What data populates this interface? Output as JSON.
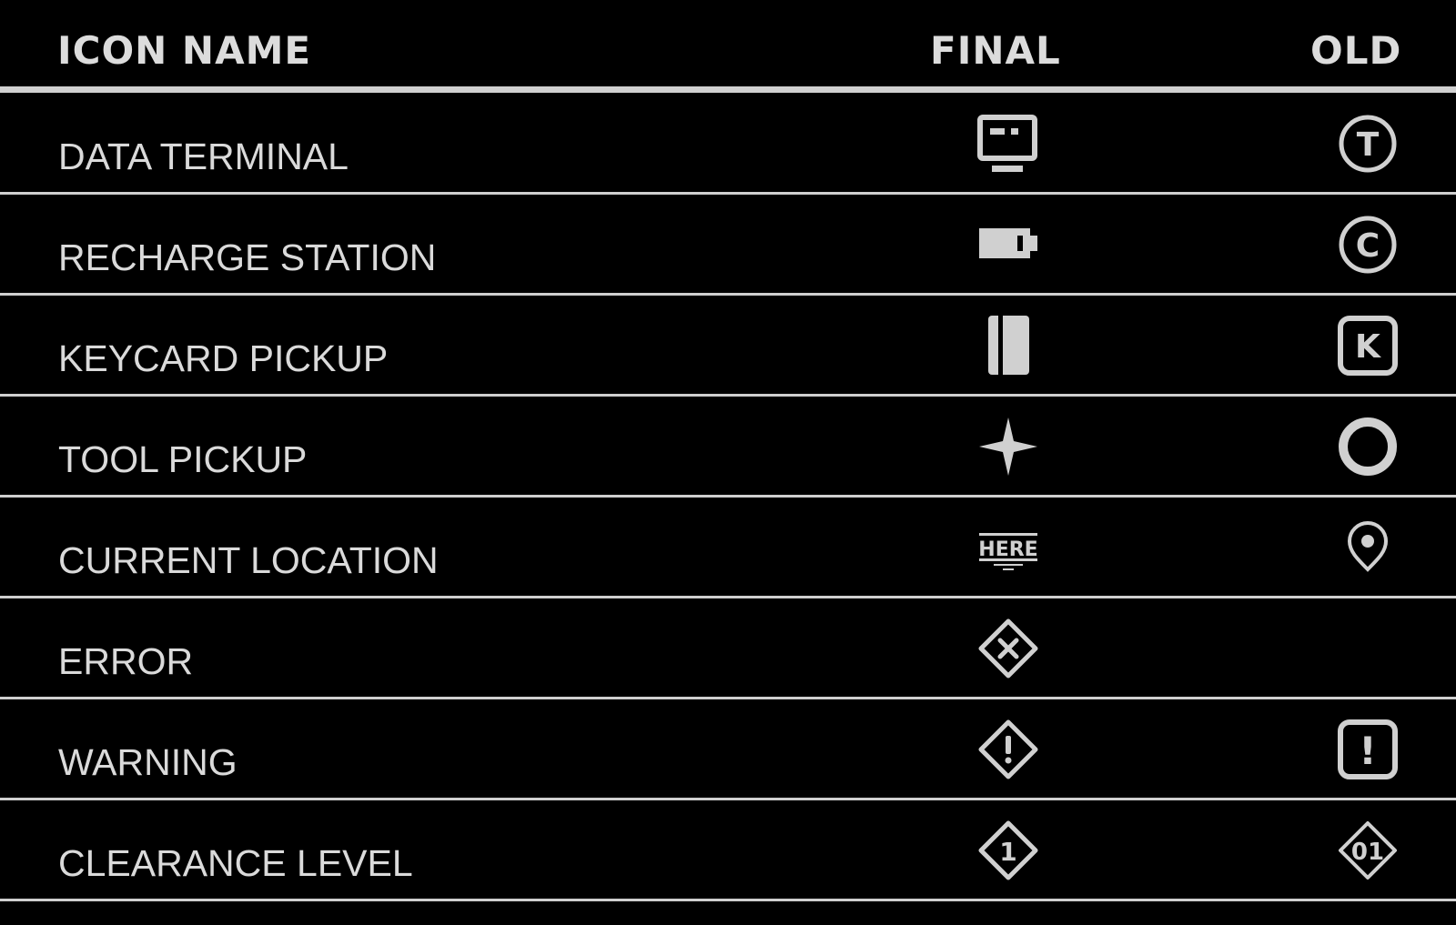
{
  "header": {
    "icon_name": "ICON NAME",
    "final": "FINAL",
    "old": "OLD"
  },
  "here_text": "HERE",
  "rows": [
    {
      "label": "DATA TERMINAL",
      "final_icon": "monitor-icon",
      "old_icon": "circle-letter-t-icon",
      "old_letter": "T"
    },
    {
      "label": "RECHARGE STATION",
      "final_icon": "battery-icon",
      "old_icon": "circle-letter-c-icon",
      "old_letter": "C"
    },
    {
      "label": "KEYCARD PICKUP",
      "final_icon": "keycard-icon",
      "old_icon": "square-letter-k-icon",
      "old_letter": "K"
    },
    {
      "label": "TOOL PICKUP",
      "final_icon": "four-point-star-icon",
      "old_icon": "ring-icon"
    },
    {
      "label": "CURRENT LOCATION",
      "final_icon": "here-marker-icon",
      "old_icon": "map-pin-icon"
    },
    {
      "label": "ERROR",
      "final_icon": "diamond-x-icon",
      "old_icon": null
    },
    {
      "label": "WARNING",
      "final_icon": "diamond-exclamation-icon",
      "old_icon": "square-exclamation-icon",
      "old_letter": "!"
    },
    {
      "label": "CLEARANCE LEVEL",
      "final_icon": "diamond-number-icon",
      "final_letter": "1",
      "old_icon": "diamond-number-icon",
      "old_letter": "01"
    }
  ],
  "colors": {
    "background": "#000000",
    "foreground": "#d0d0d0"
  }
}
